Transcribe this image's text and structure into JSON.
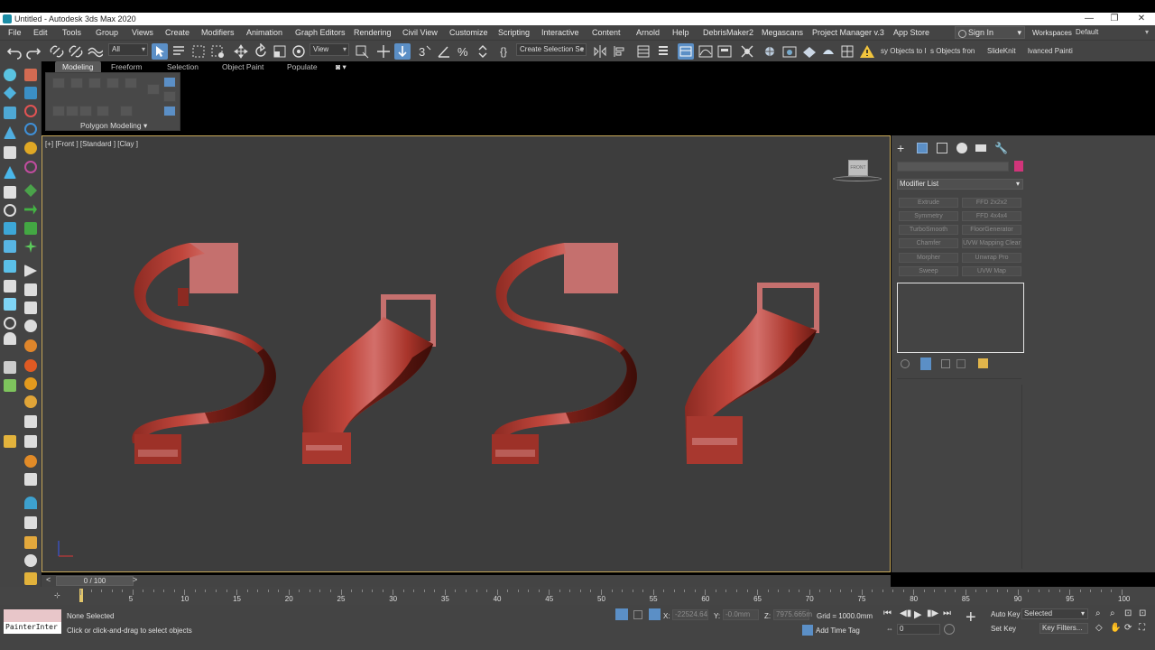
{
  "titlebar": {
    "title": "Untitled - Autodesk 3ds Max 2020",
    "minimize": "—",
    "restore": "❐",
    "close": "✕"
  },
  "menu": [
    "File",
    "Edit",
    "Tools",
    "Group",
    "Views",
    "Create",
    "Modifiers",
    "Animation",
    "Graph Editors",
    "Rendering",
    "Civil View",
    "Customize",
    "Scripting",
    "Interactive",
    "Content",
    "Arnold",
    "Help",
    "DebrisMaker2",
    "Megascans",
    "Project Manager v.3",
    "App Store"
  ],
  "signin": "Sign In",
  "workspaces": {
    "label": "Workspaces:",
    "value": "Default"
  },
  "toolbar": {
    "selection_filter": "All",
    "ref_coord": "View",
    "named_selection": "Create Selection Se",
    "script_btn1": "sy Objects to I",
    "script_btn2": "s Objects fron",
    "script_btn3": "SlideKnit",
    "script_btn4": "lvanced Painti"
  },
  "ribbon": {
    "tabs": [
      "Modeling",
      "Freeform",
      "Selection",
      "Object Paint",
      "Populate"
    ],
    "active_tab": "Modeling",
    "panel_label": "Polygon Modeling"
  },
  "viewport": {
    "label": "[+] [Front ] [Standard ] [Clay ]",
    "navcube_label": "FRONT"
  },
  "command_panel": {
    "modifier_list": "Modifier List",
    "modifier_buttons": [
      "Extrude",
      "FFD 2x2x2",
      "Symmetry",
      "FFD 4x4x4",
      "TurboSmooth",
      "FloorGenerator",
      "Chamfer",
      "UVW Mapping Clear",
      "Morpher",
      "Unwrap Pro",
      "Sweep",
      "UVW Map"
    ],
    "colors": {
      "object_color": "#d1357a"
    }
  },
  "timeline": {
    "slider_text": "0 / 100",
    "ticks": [
      "5",
      "10",
      "15",
      "20",
      "25",
      "30",
      "35",
      "40",
      "45",
      "50",
      "55",
      "60",
      "65",
      "70",
      "75",
      "80",
      "85",
      "90",
      "95",
      "100"
    ]
  },
  "status": {
    "selection": "None Selected",
    "prompt": "Click or click-and-drag to select objects",
    "maxscript_listener": "PainterInter",
    "x_label": "X:",
    "x_value": "-22524.64",
    "y_label": "Y:",
    "y_value": "-0.0mm",
    "z_label": "Z:",
    "z_value": "7975.665m",
    "grid": "Grid = 1000.0mm",
    "add_time_tag": "Add Time Tag",
    "auto_key": "Auto Key",
    "set_key": "Set Key",
    "key_mode": "Selected",
    "key_filters": "Key Filters...",
    "frame": "0"
  }
}
